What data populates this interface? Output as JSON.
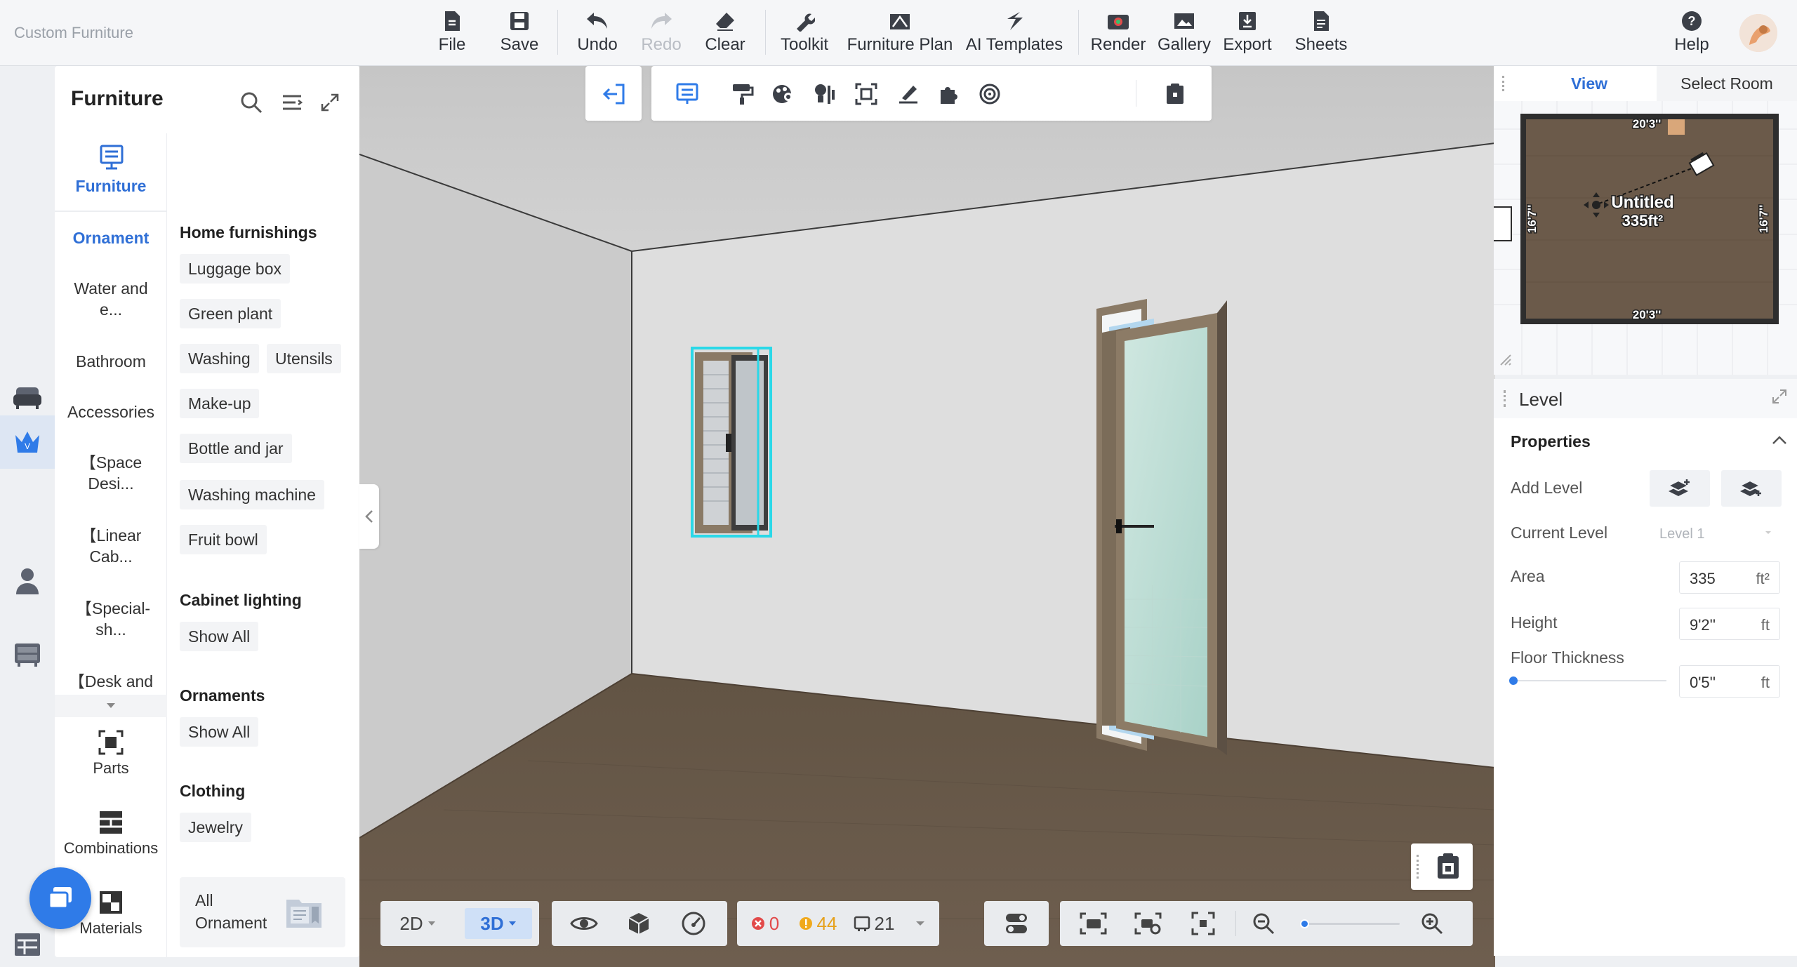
{
  "app": {
    "title": "Custom Furniture"
  },
  "toolbar": {
    "file": "File",
    "save": "Save",
    "undo": "Undo",
    "redo": "Redo",
    "clear": "Clear",
    "toolkit": "Toolkit",
    "furniture_plan": "Furniture Plan",
    "ai_templates": "AI Templates",
    "render": "Render",
    "gallery": "Gallery",
    "export": "Export",
    "sheets": "Sheets",
    "help": "Help"
  },
  "catalog": {
    "title": "Furniture",
    "tab_label": "Furniture",
    "categories": [
      "Ornament",
      "Water and e...",
      "Bathroom",
      "Accessories",
      "【Space Desi...",
      "【Linear Cab...",
      "【Special-sh...",
      "【Desk and"
    ],
    "tools": [
      "Parts",
      "Combinations",
      "Materials"
    ],
    "sections": {
      "home": {
        "title": "Home furnishings",
        "items": [
          "Luggage box",
          "Green plant",
          "Washing",
          "Utensils",
          "Make-up",
          "Bottle and jar",
          "Washing machine",
          "Fruit bowl"
        ]
      },
      "cabinet": {
        "title": "Cabinet lighting",
        "items": [
          "Show All"
        ]
      },
      "ornaments": {
        "title": "Ornaments",
        "items": [
          "Show All"
        ]
      },
      "clothing": {
        "title": "Clothing",
        "items": [
          "Jewelry"
        ]
      }
    },
    "all_ornament": {
      "line1": "All",
      "line2": "Ornament"
    }
  },
  "bottom_bar": {
    "mode_2d": "2D",
    "mode_3d": "3D",
    "errors": "0",
    "warnings": "44",
    "items": "21"
  },
  "right_panel": {
    "tabs": [
      "View",
      "Select Room"
    ],
    "minimap": {
      "room_name": "Untitled",
      "room_area": "335ft²",
      "width_top": "20'3''",
      "width_bottom": "20'3''",
      "depth_left": "16'7''",
      "depth_right": "16'7''"
    },
    "level_title": "Level",
    "properties_title": "Properties",
    "add_level": "Add Level",
    "current_level": "Current Level",
    "current_level_value": "Level 1",
    "area": "Area",
    "area_value": "335",
    "area_unit": "ft²",
    "height": "Height",
    "height_value": "9'2''",
    "height_unit": "ft",
    "floor_thickness": "Floor Thickness",
    "floor_thickness_value": "0'5''",
    "floor_thickness_unit": "ft"
  },
  "colors": {
    "accent": "#2f6fd6",
    "selection": "#2ad8e8",
    "floor": "#6a5a4c",
    "wall": "#dcdcdc"
  }
}
